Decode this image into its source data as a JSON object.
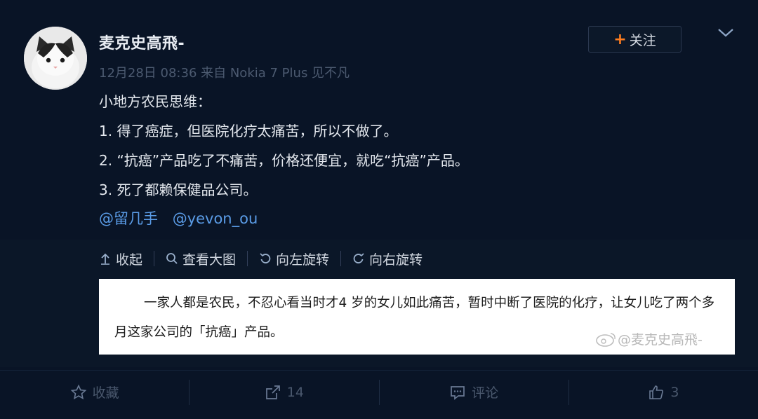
{
  "post": {
    "username": "麦克史高飛-",
    "meta": "12月28日 08:36 来自 Nokia 7 Plus 见不凡",
    "follow_label": "关注",
    "lines": [
      "小地方农民思维：",
      "1. 得了癌症，但医院化疗太痛苦，所以不做了。",
      "2. “抗癌”产品吃了不痛苦，价格还便宜，就吃“抗癌”产品。",
      "3. 死了都赖保健品公司。"
    ],
    "mentions": [
      "@留几手",
      "@yevon_ou"
    ]
  },
  "media_toolbar": {
    "collapse": "收起",
    "view_large": "查看大图",
    "rotate_left": "向左旋转",
    "rotate_right": "向右旋转"
  },
  "image_text": "一家人都是农民，不忍心看当时才4 岁的女儿如此痛苦，暂时中断了医院的化疗，让女儿吃了两个多月这家公司的「抗癌」产品。",
  "watermark": "@麦克史高飛-",
  "actions": {
    "favorite": "收藏",
    "repost_count": "14",
    "comment": "评论",
    "like_count": "3"
  },
  "colors": {
    "background": "#091426",
    "link": "#5b9de8",
    "follow_plus": "#ff7d1f"
  }
}
